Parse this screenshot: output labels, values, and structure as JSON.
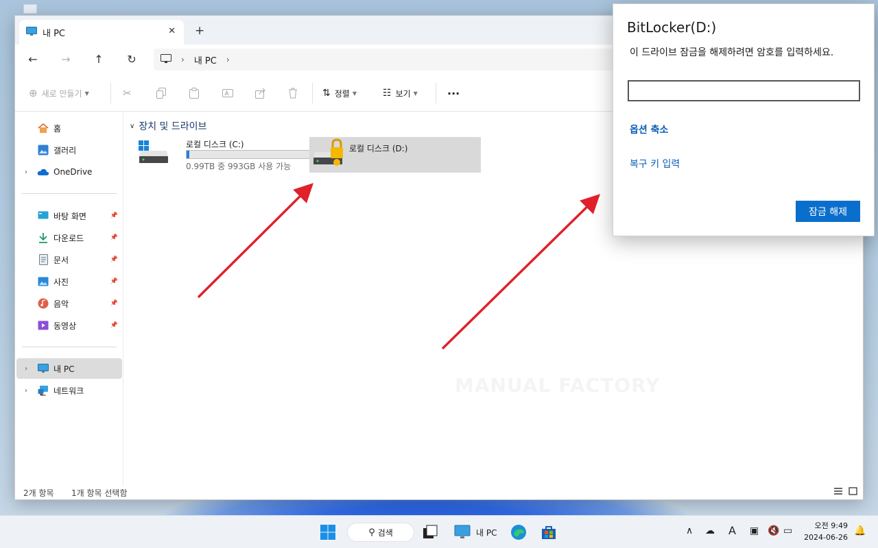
{
  "window": {
    "tab_label": "내 PC",
    "tab_close": "✕",
    "new_tab": "+"
  },
  "nav": {
    "back": "←",
    "forward": "→",
    "up": "↑",
    "refresh": "↻",
    "address": [
      "내 PC"
    ],
    "sep": "›"
  },
  "toolbar": {
    "new_label": "새로 만들기",
    "sort_label": "정렬",
    "view_label": "보기",
    "more": "···"
  },
  "sidebar": {
    "home": "홈",
    "gallery": "갤러리",
    "onedrive": "OneDrive",
    "desktop": "바탕 화면",
    "downloads": "다운로드",
    "documents": "문서",
    "pictures": "사진",
    "music": "음악",
    "videos": "동영상",
    "this_pc": "내 PC",
    "network": "네트워크"
  },
  "content": {
    "group_title": "장치 및 드라이브",
    "drives": [
      {
        "name": "로컬 디스크 (C:)",
        "space": "0.99TB 중 993GB 사용 가능",
        "used_fraction": 0.02
      },
      {
        "name": "로컬 디스크 (D:)"
      }
    ],
    "watermark": "MANUAL FACTORY"
  },
  "status": {
    "count": "2개 항목",
    "selected": "1개 항목 선택함"
  },
  "bitlocker": {
    "title": "BitLocker(D:)",
    "description": "이 드라이브 잠금을 해제하려면 암호를 입력하세요.",
    "password_value": "",
    "fewer_options": "옵션 축소",
    "recovery_key": "복구 키 입력",
    "unlock_button": "잠금 해제"
  },
  "taskbar": {
    "search_label": "검색",
    "explorer_label": "내 PC",
    "time": "오전 9:49",
    "date": "2024-06-26"
  },
  "colors": {
    "accent": "#0a6fcc",
    "link": "#0a5fb5",
    "arrow": "#e0202a",
    "lock": "#f5b800"
  }
}
